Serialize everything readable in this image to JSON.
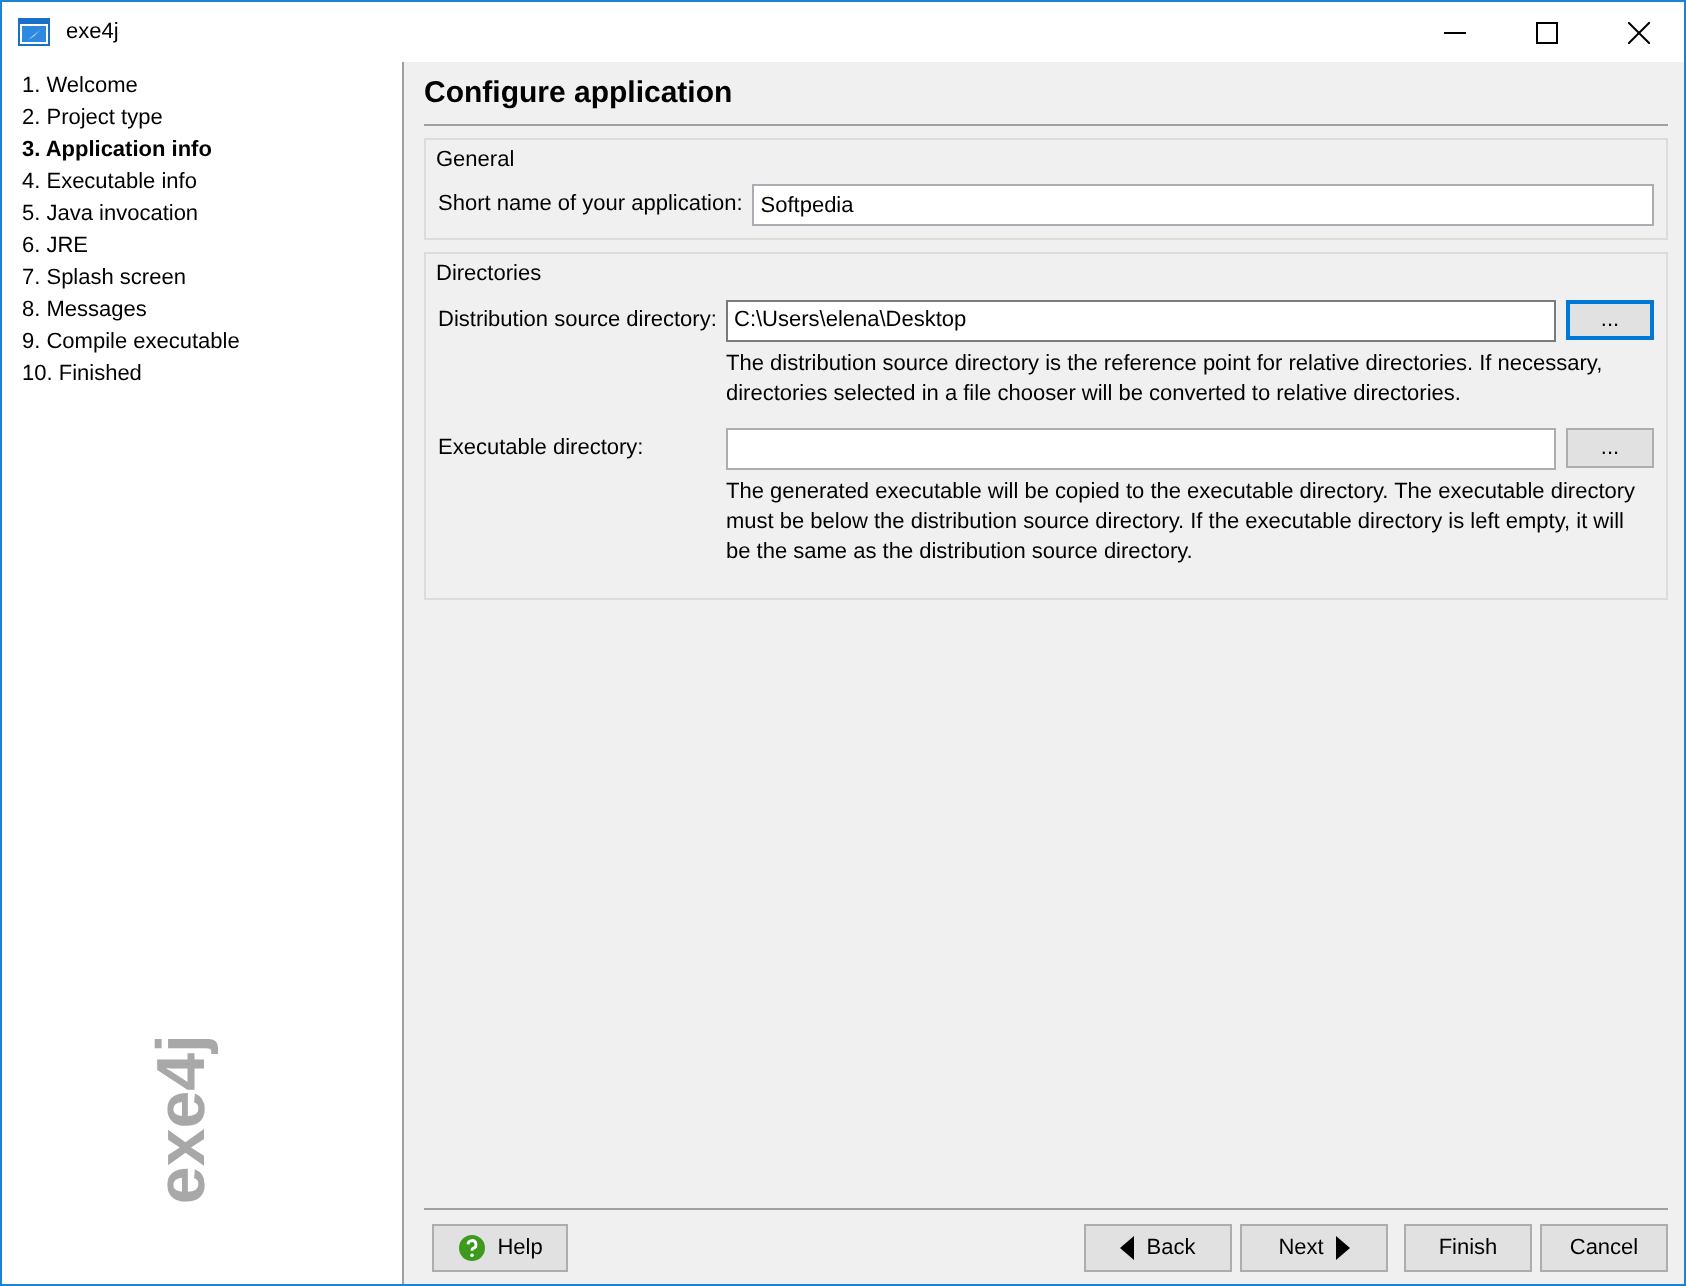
{
  "window": {
    "title": "exe4j"
  },
  "sidebar": {
    "items": [
      {
        "label": "1. Welcome",
        "selected": false
      },
      {
        "label": "2. Project type",
        "selected": false
      },
      {
        "label": "3. Application info",
        "selected": true
      },
      {
        "label": "4. Executable info",
        "selected": false
      },
      {
        "label": "5. Java invocation",
        "selected": false
      },
      {
        "label": "6. JRE",
        "selected": false
      },
      {
        "label": "7. Splash screen",
        "selected": false
      },
      {
        "label": "8. Messages",
        "selected": false
      },
      {
        "label": "9. Compile executable",
        "selected": false
      },
      {
        "label": "10. Finished",
        "selected": false
      }
    ],
    "logo": "exe4j"
  },
  "page_title": "Configure application",
  "groups": [
    {
      "title": "General",
      "fields": [
        {
          "label": "Short name of your application:",
          "value": "Softpedia"
        }
      ]
    },
    {
      "title": "Directories",
      "fields": [
        {
          "label": "Distribution source directory:",
          "value": "C:\\Users\\elena\\Desktop",
          "browse_label": "...",
          "focused": true,
          "hint": "The distribution source directory is the reference point for relative directories. If necessary, directories selected in a file chooser will be converted to relative directories."
        },
        {
          "label": "Executable directory:",
          "browse_label": "...",
          "focused": false,
          "hint": "The generated executable will be copied to the executable directory. The executable directory must be below the distribution source directory. If the executable directory is left empty, it will be the same as the distribution source directory."
        }
      ]
    }
  ],
  "buttons": {
    "help": "Help",
    "back": "Back",
    "next": "Next",
    "finish": "Finish",
    "cancel": "Cancel"
  }
}
